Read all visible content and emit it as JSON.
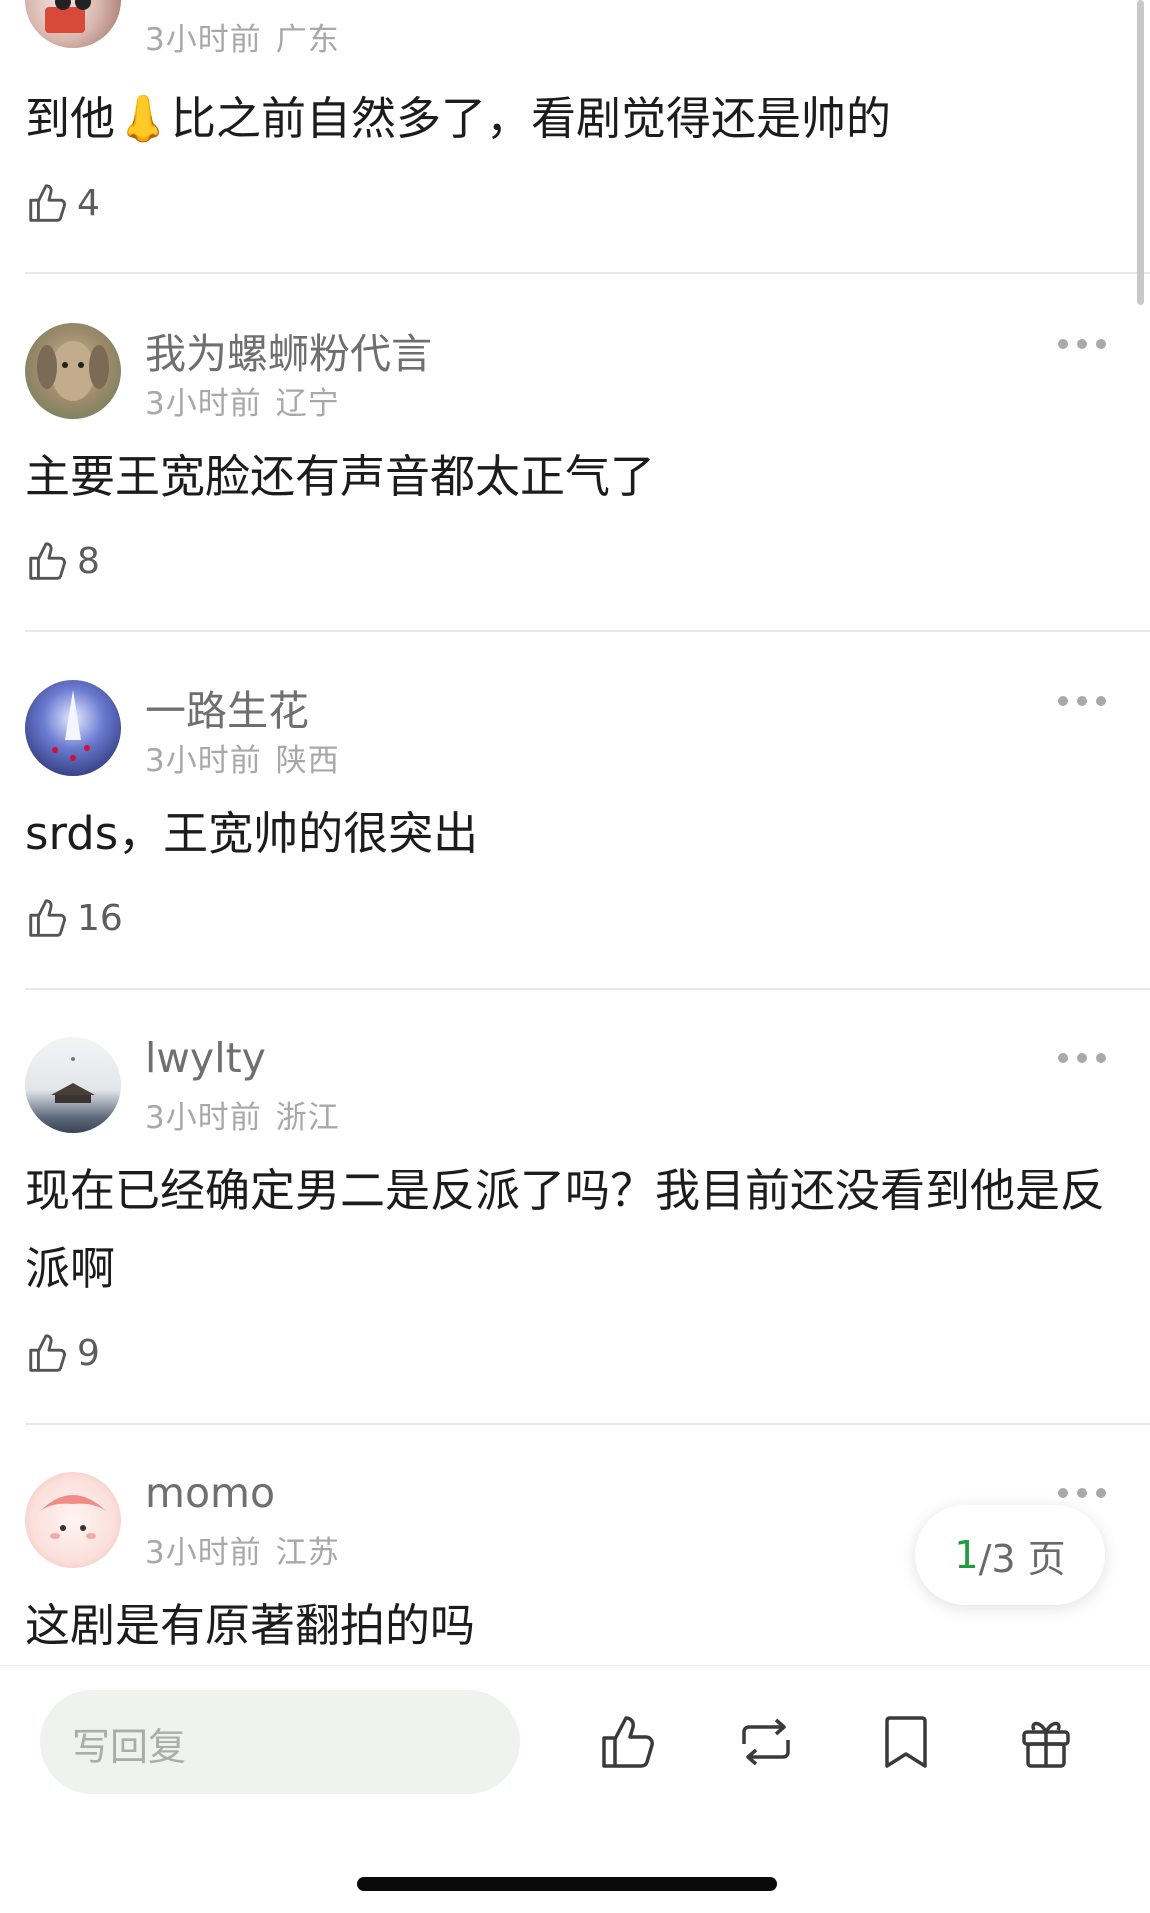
{
  "comments": [
    {
      "time": "3小时前",
      "region": "广东",
      "text": "到他👃比之前自然多了，看剧觉得还是帅的",
      "likes": "4"
    },
    {
      "username": "我为螺蛳粉代言",
      "time": "3小时前",
      "region": "辽宁",
      "text": "主要王宽脸还有声音都太正气了",
      "likes": "8"
    },
    {
      "username": "一路生花",
      "time": "3小时前",
      "region": "陕西",
      "text": "srds，王宽帅的很突出",
      "likes": "16"
    },
    {
      "username": "lwylty",
      "time": "3小时前",
      "region": "浙江",
      "text": "现在已经确定男二是反派了吗？我目前还没看到他是反派啊",
      "likes": "9"
    },
    {
      "username": "momo",
      "time": "3小时前",
      "region": "江苏",
      "text": "这剧是有原著翻拍的吗"
    }
  ],
  "pager": {
    "current": "1",
    "total": "/3 页"
  },
  "bottom_bar": {
    "reply_placeholder": "写回复"
  },
  "icons": [
    "thumb-up-icon",
    "more-icon",
    "repost-icon",
    "bookmark-icon",
    "gift-icon"
  ],
  "colors": {
    "accent": "#1f9d3c",
    "text": "#1c1c1c",
    "meta": "#a8a8a8"
  }
}
